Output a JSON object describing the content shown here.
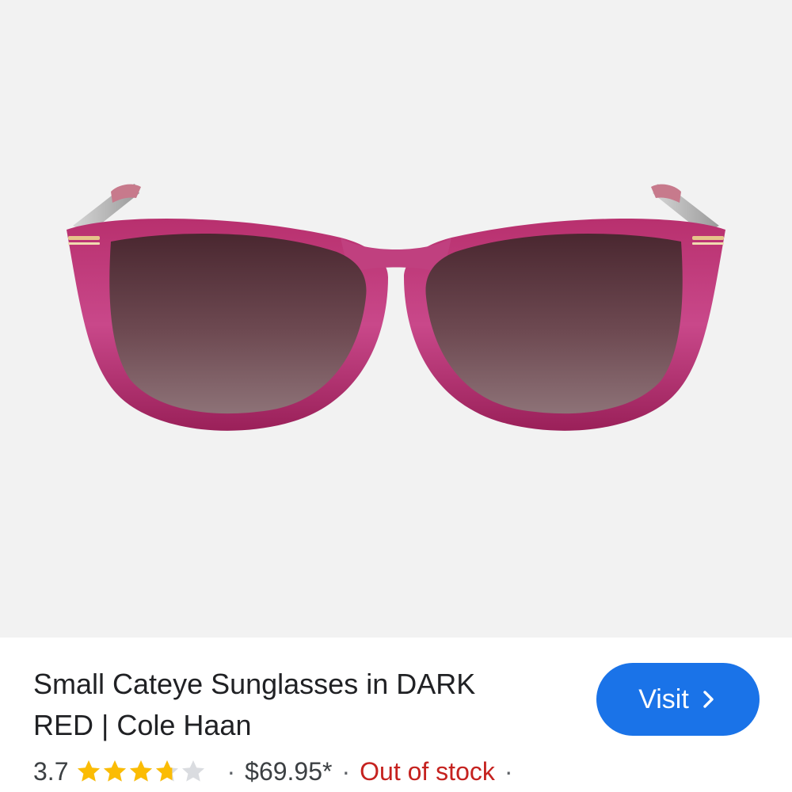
{
  "product": {
    "title_line1": "Small Cateye Sunglasses in DARK",
    "title_line2": "RED | Cole Haan",
    "image_icon": "sunglasses-image",
    "rating": {
      "value_text": "3.7",
      "value": 3.7,
      "max": 5,
      "star_color": "#fbbc04",
      "empty_star_color": "#dadce0"
    },
    "separator": "·",
    "price": "$69.95*",
    "stock_status": "Out of stock",
    "stock_color": "#c5221f"
  },
  "visit_button": {
    "label": "Visit",
    "icon": "chevron-right-icon",
    "color": "#1a73e8"
  }
}
